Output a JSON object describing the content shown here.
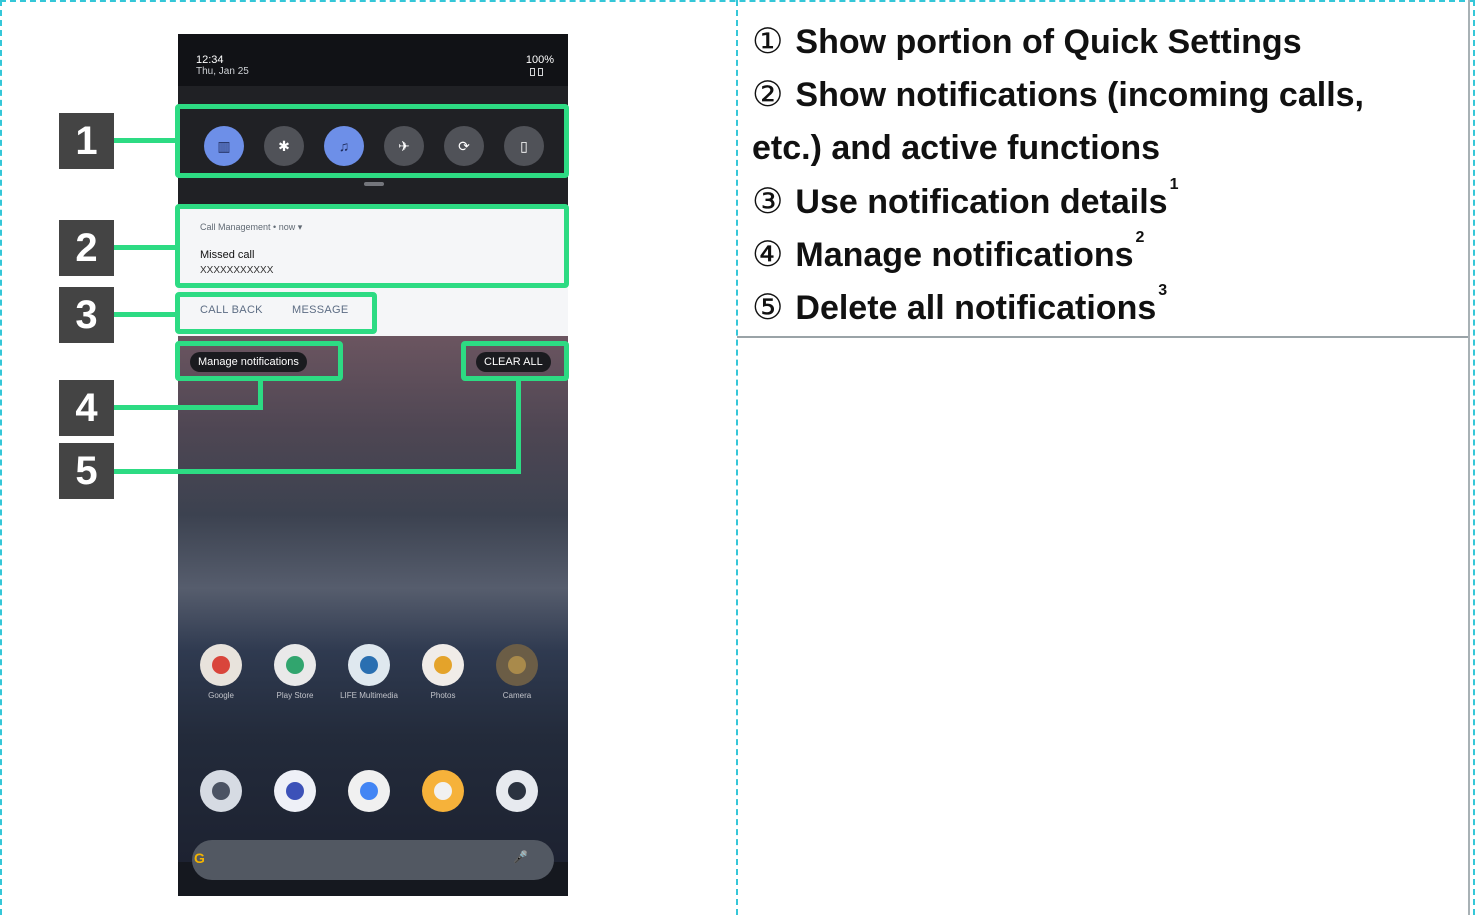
{
  "phone": {
    "status": {
      "time": "12:34",
      "battery": "100%"
    },
    "date": "Thu, Jan 25",
    "qs_tiles": [
      {
        "icon": "wifi-icon",
        "symbol": "▥",
        "active": true
      },
      {
        "icon": "bluetooth-icon",
        "symbol": "✱",
        "active": false
      },
      {
        "icon": "bell-icon",
        "symbol": "♫",
        "active": true
      },
      {
        "icon": "airplane-icon",
        "symbol": "✈",
        "active": false
      },
      {
        "icon": "auto-rotate-icon",
        "symbol": "⟳",
        "active": false
      },
      {
        "icon": "flashlight-icon",
        "symbol": "▯",
        "active": false
      }
    ],
    "notification": {
      "source": "Call Management • now ▾",
      "title": "Missed call",
      "body": "XXXXXXXXXXX",
      "actions": [
        "CALL BACK",
        "MESSAGE"
      ]
    },
    "manage_label": "Manage notifications",
    "clear_label": "CLEAR ALL",
    "apps_row1": [
      "Google",
      "Play Store",
      "LIFE Multimedia",
      "Photos",
      "Camera"
    ],
    "apps_row2": [],
    "search": {
      "mic": "🎤"
    }
  },
  "callouts": [
    "1",
    "2",
    "3",
    "4",
    "5"
  ],
  "descriptions": [
    {
      "circled": "①",
      "text": "Show portion of Quick Settings",
      "sup": ""
    },
    {
      "circled": "②",
      "text": "Show notifications (incoming calls,",
      "sup": ""
    },
    {
      "circled": "",
      "text": "etc.) and active functions",
      "sup": ""
    },
    {
      "circled": "③",
      "text": "Use notification details",
      "sup": "1"
    },
    {
      "circled": "④",
      "text": "Manage notifications",
      "sup": "2"
    },
    {
      "circled": "⑤",
      "text": "Delete all notifications",
      "sup": "3"
    }
  ],
  "colors": {
    "highlight": "#2ddb83",
    "frame": "#35c7d8",
    "callout_bg": "#444444"
  }
}
